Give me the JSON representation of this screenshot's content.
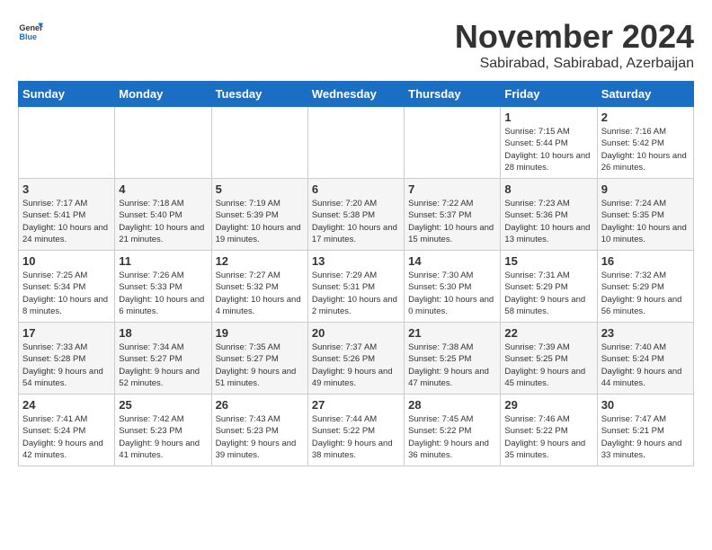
{
  "header": {
    "logo_line1": "General",
    "logo_line2": "Blue",
    "month_title": "November 2024",
    "subtitle": "Sabirabad, Sabirabad, Azerbaijan"
  },
  "days_of_week": [
    "Sunday",
    "Monday",
    "Tuesday",
    "Wednesday",
    "Thursday",
    "Friday",
    "Saturday"
  ],
  "weeks": [
    [
      {
        "day": "",
        "info": ""
      },
      {
        "day": "",
        "info": ""
      },
      {
        "day": "",
        "info": ""
      },
      {
        "day": "",
        "info": ""
      },
      {
        "day": "",
        "info": ""
      },
      {
        "day": "1",
        "info": "Sunrise: 7:15 AM\nSunset: 5:44 PM\nDaylight: 10 hours and 28 minutes."
      },
      {
        "day": "2",
        "info": "Sunrise: 7:16 AM\nSunset: 5:42 PM\nDaylight: 10 hours and 26 minutes."
      }
    ],
    [
      {
        "day": "3",
        "info": "Sunrise: 7:17 AM\nSunset: 5:41 PM\nDaylight: 10 hours and 24 minutes."
      },
      {
        "day": "4",
        "info": "Sunrise: 7:18 AM\nSunset: 5:40 PM\nDaylight: 10 hours and 21 minutes."
      },
      {
        "day": "5",
        "info": "Sunrise: 7:19 AM\nSunset: 5:39 PM\nDaylight: 10 hours and 19 minutes."
      },
      {
        "day": "6",
        "info": "Sunrise: 7:20 AM\nSunset: 5:38 PM\nDaylight: 10 hours and 17 minutes."
      },
      {
        "day": "7",
        "info": "Sunrise: 7:22 AM\nSunset: 5:37 PM\nDaylight: 10 hours and 15 minutes."
      },
      {
        "day": "8",
        "info": "Sunrise: 7:23 AM\nSunset: 5:36 PM\nDaylight: 10 hours and 13 minutes."
      },
      {
        "day": "9",
        "info": "Sunrise: 7:24 AM\nSunset: 5:35 PM\nDaylight: 10 hours and 10 minutes."
      }
    ],
    [
      {
        "day": "10",
        "info": "Sunrise: 7:25 AM\nSunset: 5:34 PM\nDaylight: 10 hours and 8 minutes."
      },
      {
        "day": "11",
        "info": "Sunrise: 7:26 AM\nSunset: 5:33 PM\nDaylight: 10 hours and 6 minutes."
      },
      {
        "day": "12",
        "info": "Sunrise: 7:27 AM\nSunset: 5:32 PM\nDaylight: 10 hours and 4 minutes."
      },
      {
        "day": "13",
        "info": "Sunrise: 7:29 AM\nSunset: 5:31 PM\nDaylight: 10 hours and 2 minutes."
      },
      {
        "day": "14",
        "info": "Sunrise: 7:30 AM\nSunset: 5:30 PM\nDaylight: 10 hours and 0 minutes."
      },
      {
        "day": "15",
        "info": "Sunrise: 7:31 AM\nSunset: 5:29 PM\nDaylight: 9 hours and 58 minutes."
      },
      {
        "day": "16",
        "info": "Sunrise: 7:32 AM\nSunset: 5:29 PM\nDaylight: 9 hours and 56 minutes."
      }
    ],
    [
      {
        "day": "17",
        "info": "Sunrise: 7:33 AM\nSunset: 5:28 PM\nDaylight: 9 hours and 54 minutes."
      },
      {
        "day": "18",
        "info": "Sunrise: 7:34 AM\nSunset: 5:27 PM\nDaylight: 9 hours and 52 minutes."
      },
      {
        "day": "19",
        "info": "Sunrise: 7:35 AM\nSunset: 5:27 PM\nDaylight: 9 hours and 51 minutes."
      },
      {
        "day": "20",
        "info": "Sunrise: 7:37 AM\nSunset: 5:26 PM\nDaylight: 9 hours and 49 minutes."
      },
      {
        "day": "21",
        "info": "Sunrise: 7:38 AM\nSunset: 5:25 PM\nDaylight: 9 hours and 47 minutes."
      },
      {
        "day": "22",
        "info": "Sunrise: 7:39 AM\nSunset: 5:25 PM\nDaylight: 9 hours and 45 minutes."
      },
      {
        "day": "23",
        "info": "Sunrise: 7:40 AM\nSunset: 5:24 PM\nDaylight: 9 hours and 44 minutes."
      }
    ],
    [
      {
        "day": "24",
        "info": "Sunrise: 7:41 AM\nSunset: 5:24 PM\nDaylight: 9 hours and 42 minutes."
      },
      {
        "day": "25",
        "info": "Sunrise: 7:42 AM\nSunset: 5:23 PM\nDaylight: 9 hours and 41 minutes."
      },
      {
        "day": "26",
        "info": "Sunrise: 7:43 AM\nSunset: 5:23 PM\nDaylight: 9 hours and 39 minutes."
      },
      {
        "day": "27",
        "info": "Sunrise: 7:44 AM\nSunset: 5:22 PM\nDaylight: 9 hours and 38 minutes."
      },
      {
        "day": "28",
        "info": "Sunrise: 7:45 AM\nSunset: 5:22 PM\nDaylight: 9 hours and 36 minutes."
      },
      {
        "day": "29",
        "info": "Sunrise: 7:46 AM\nSunset: 5:22 PM\nDaylight: 9 hours and 35 minutes."
      },
      {
        "day": "30",
        "info": "Sunrise: 7:47 AM\nSunset: 5:21 PM\nDaylight: 9 hours and 33 minutes."
      }
    ]
  ]
}
